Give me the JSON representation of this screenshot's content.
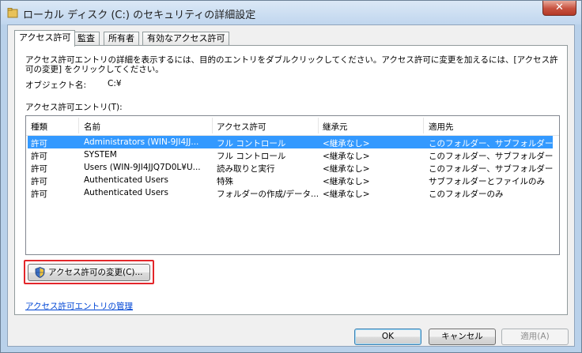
{
  "window": {
    "title": "ローカル ディスク (C:) のセキュリティの詳細設定",
    "close_glyph": "✕"
  },
  "tabs": [
    {
      "label": "アクセス許可",
      "active": true
    },
    {
      "label": "監査",
      "active": false
    },
    {
      "label": "所有者",
      "active": false
    },
    {
      "label": "有効なアクセス許可",
      "active": false
    }
  ],
  "description": "アクセス許可エントリの詳細を表示するには、目的のエントリをダブルクリックしてください。アクセス許可に変更を加えるには、[アクセス許可の変更] をクリックしてください。",
  "object": {
    "label": "オブジェクト名:",
    "value": "C:¥"
  },
  "entries_label": "アクセス許可エントリ(T):",
  "columns": [
    "種類",
    "名前",
    "アクセス許可",
    "継承元",
    "適用先"
  ],
  "rows": [
    [
      "許可",
      "Administrators (WIN-9JI4JJ...",
      "フル コントロール",
      "<継承なし>",
      "このフォルダー、サブフォルダーお..."
    ],
    [
      "許可",
      "SYSTEM",
      "フル コントロール",
      "<継承なし>",
      "このフォルダー、サブフォルダーお..."
    ],
    [
      "許可",
      "Users (WIN-9JI4JJQ7D0L¥U...",
      "読み取りと実行",
      "<継承なし>",
      "このフォルダー、サブフォルダーお..."
    ],
    [
      "許可",
      "Authenticated Users",
      "特殊",
      "<継承なし>",
      "サブフォルダーとファイルのみ"
    ],
    [
      "許可",
      "Authenticated Users",
      "フォルダーの作成/データ...",
      "<継承なし>",
      "このフォルダーのみ"
    ]
  ],
  "selected_row": 0,
  "change_button": "アクセス許可の変更(C)...",
  "manage_link": "アクセス許可エントリの管理",
  "buttons": {
    "ok": "OK",
    "cancel": "キャンセル",
    "apply": "適用(A)"
  },
  "colors": {
    "selection": "#3399ff",
    "highlight": "#e3262a",
    "link": "#0046d5"
  }
}
